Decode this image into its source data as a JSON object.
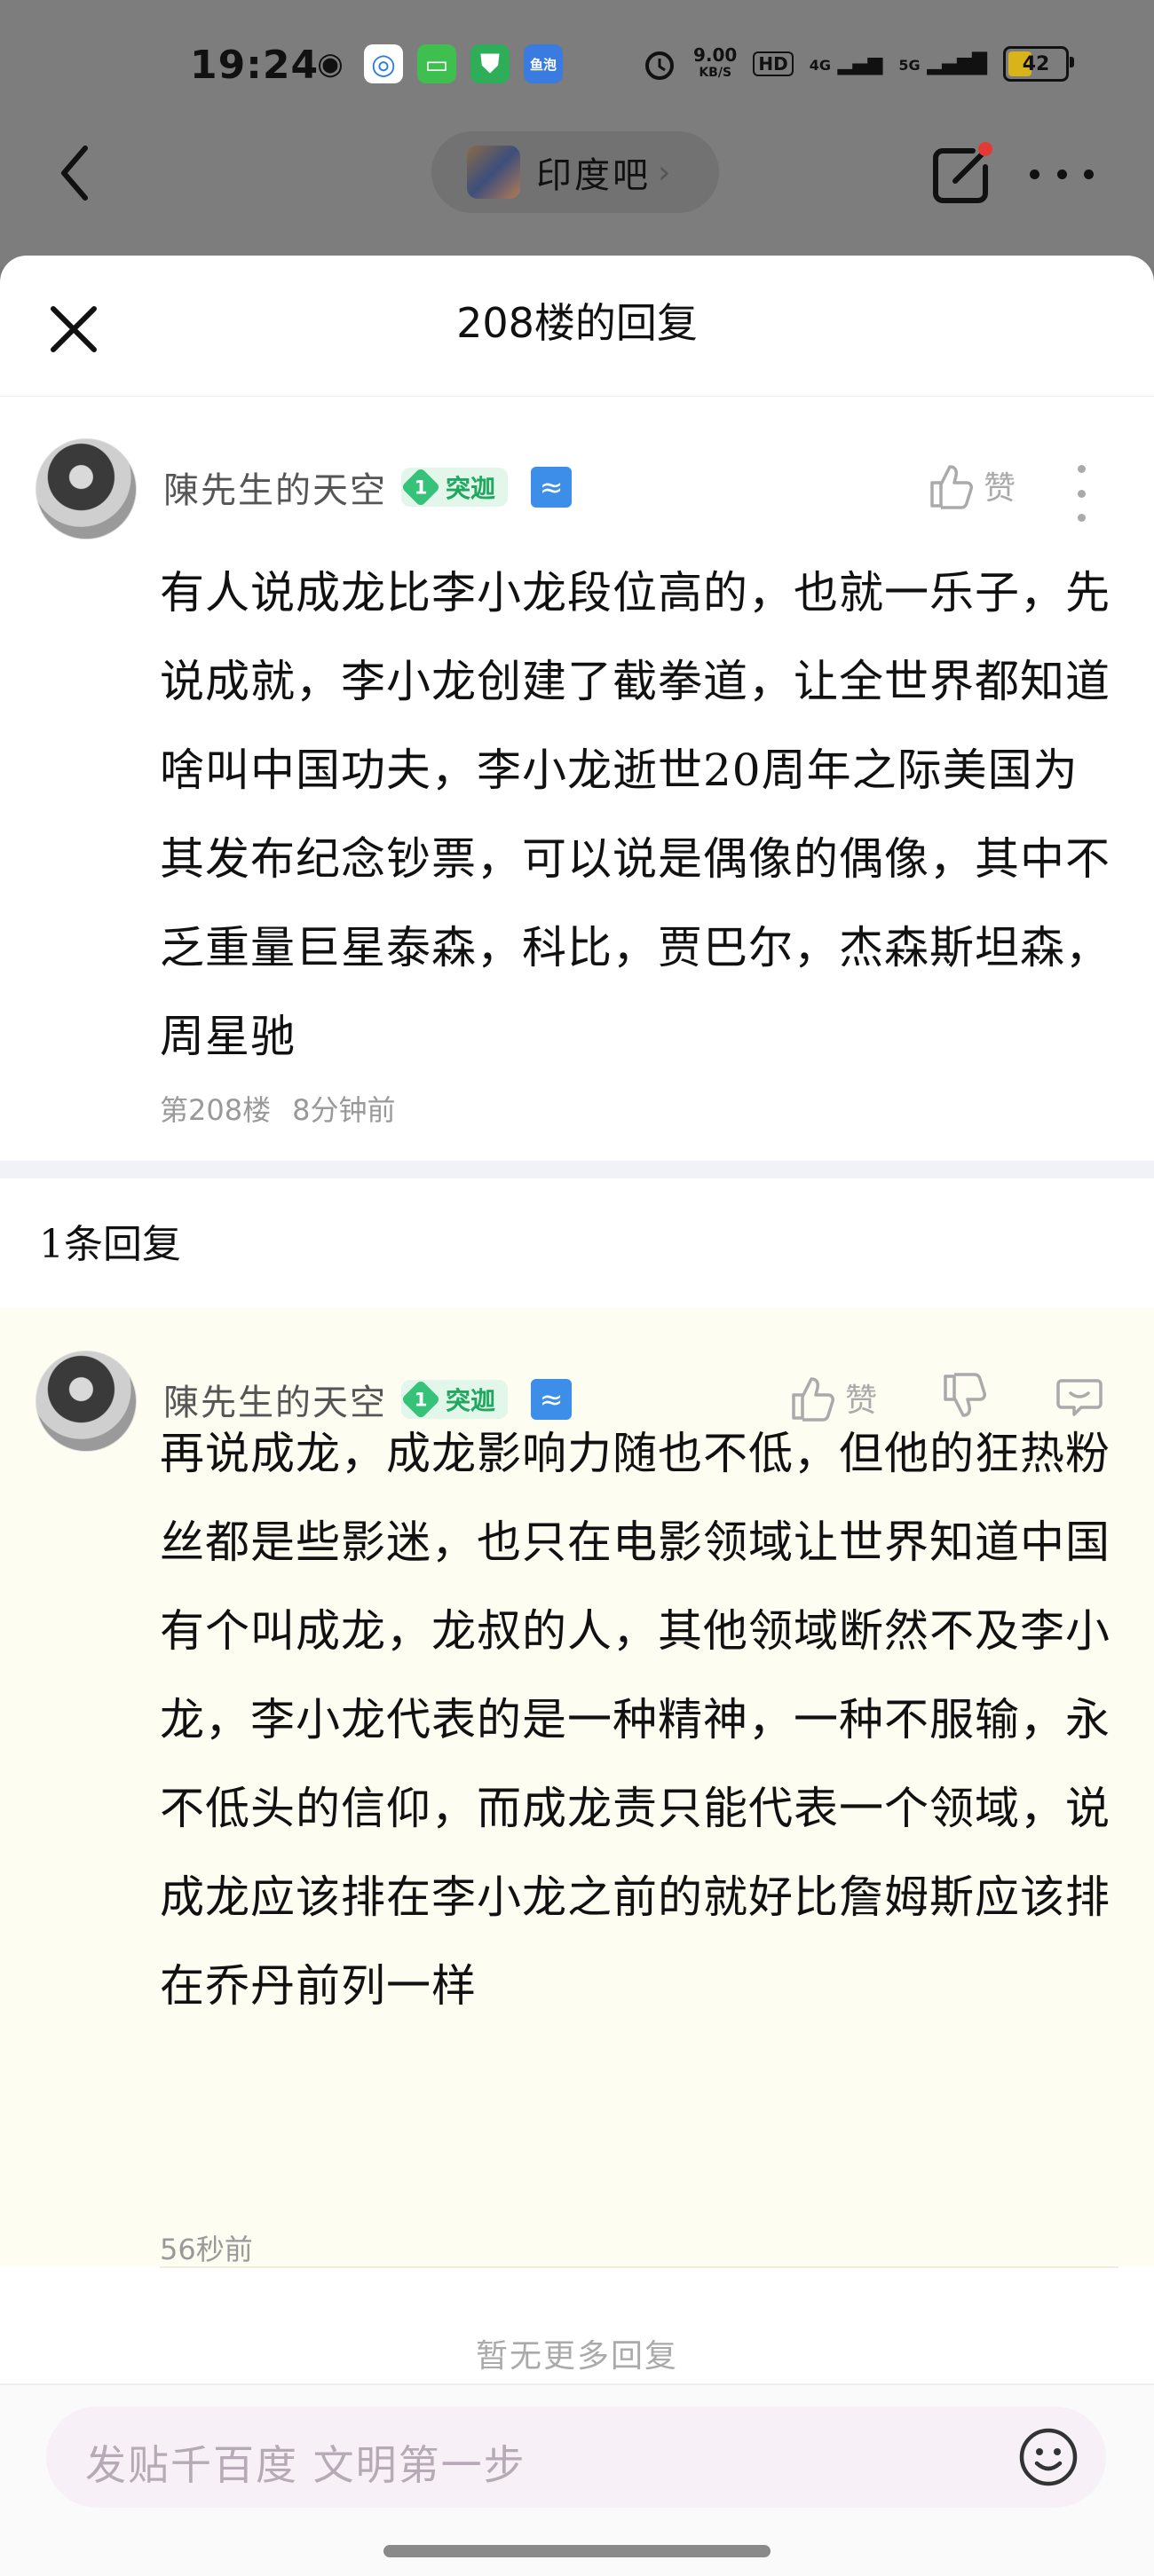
{
  "status_bar": {
    "time": "19:24",
    "app_icons": [
      {
        "name": "wechat",
        "color": "#222222",
        "label": "◉"
      },
      {
        "name": "browser",
        "color": "#ffffff",
        "label": "◎"
      },
      {
        "name": "messages",
        "color": "#3fbf4f",
        "label": "▭"
      },
      {
        "name": "security",
        "color": "#2fae5a",
        "label": "⛊"
      },
      {
        "name": "yupao",
        "color": "#3a7be0",
        "label": "鱼泡"
      }
    ],
    "net_speed_value": "9.00",
    "net_speed_unit": "KB/S",
    "hd_label": "HD",
    "signal_1": "4G",
    "signal_2": "5G",
    "battery_level": "42",
    "battery_color": "#d8b41a"
  },
  "nav": {
    "forum_name": "印度吧",
    "forum_chevron": "›"
  },
  "sheet": {
    "title": "208楼的回复"
  },
  "post": {
    "username": "陳先生的天空",
    "level": "1",
    "level_name": "突迦",
    "zodiac_symbol": "≈",
    "like_label": "赞",
    "text": "有人说成龙比李小龙段位高的，也就一乐子，先说成就，李小龙创建了截拳道，让全世界都知道啥叫中国功夫，李小龙逝世20周年之际美国为其发布纪念钞票，可以说是偶像的偶像，其中不乏重量巨星泰森，科比，贾巴尔，杰森斯坦森，周星驰",
    "floor": "第208楼",
    "time": "8分钟前"
  },
  "reply_count_label": "1条回复",
  "reply": {
    "username": "陳先生的天空",
    "level": "1",
    "level_name": "突迦",
    "zodiac_symbol": "≈",
    "like_label": "赞",
    "text": "再说成龙，成龙影响力随也不低，但他的狂热粉丝都是些影迷，也只在电影领域让世界知道中国有个叫成龙，龙叔的人，其他领域断然不及李小龙，李小龙代表的是一种精神，一种不服输，永不低头的信仰，而成龙责只能代表一个领域，说成龙应该排在李小龙之前的就好比詹姆斯应该排在乔丹前列一样",
    "time": "56秒前"
  },
  "no_more_label": "暂无更多回复",
  "input": {
    "placeholder": "发贴千百度 文明第一步"
  },
  "colors": {
    "reply_bg": "#fdfdf1",
    "level_green": "#37c27a",
    "zodiac_blue": "#3d8ee8",
    "notification_red": "#e53935"
  }
}
